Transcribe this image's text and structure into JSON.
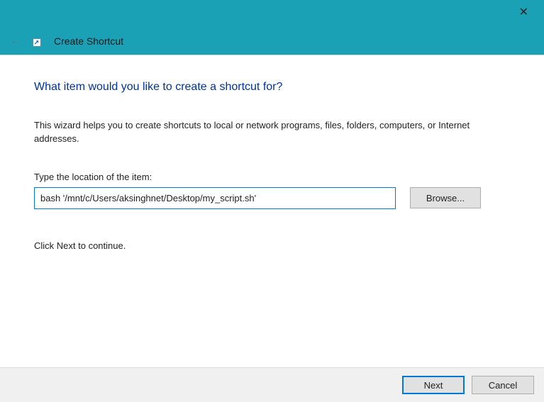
{
  "titlebar": {
    "title": "Create Shortcut"
  },
  "content": {
    "heading": "What item would you like to create a shortcut for?",
    "description": "This wizard helps you to create shortcuts to local or network programs, files, folders, computers, or Internet addresses.",
    "field_label": "Type the location of the item:",
    "path_value": "bash '/mnt/c/Users/aksinghnet/Desktop/my_script.sh'",
    "browse_label": "Browse...",
    "continue_text": "Click Next to continue."
  },
  "footer": {
    "next_label": "Next",
    "cancel_label": "Cancel"
  }
}
